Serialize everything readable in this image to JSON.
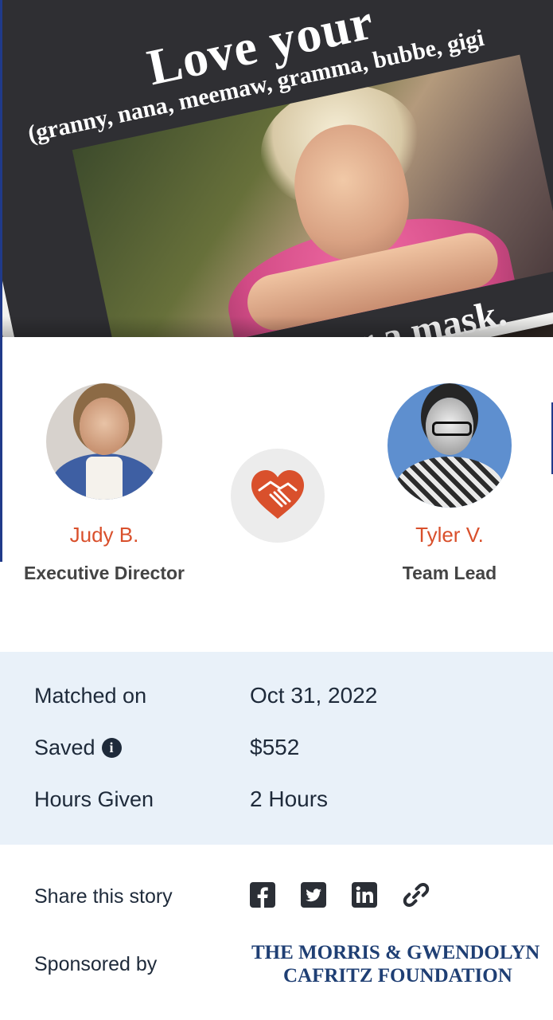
{
  "hero": {
    "card_title": "Love your",
    "card_subtitle": "(granny, nana, meemaw, gramma, bubbe, gigi",
    "card_footer": "Wear a mask."
  },
  "match": {
    "left": {
      "name": "Judy B.",
      "role": "Executive Director"
    },
    "right": {
      "name": "Tyler V.",
      "role": "Team Lead"
    },
    "center_icon": "handshake-heart-icon",
    "accent_color": "#d9502c"
  },
  "stats": {
    "rows": [
      {
        "label": "Matched on",
        "value": "Oct 31, 2022"
      },
      {
        "label": "Saved",
        "value": "$552"
      },
      {
        "label": "Hours Given",
        "value": "2 Hours"
      }
    ],
    "background_color": "#e9f1f9"
  },
  "share": {
    "label": "Share this story",
    "icons": [
      "facebook-icon",
      "twitter-icon",
      "linkedin-icon",
      "link-icon"
    ]
  },
  "sponsor": {
    "label": "Sponsored by",
    "line1": "THE MORRIS & GWENDOLYN",
    "line2": "CAFRITZ FOUNDATION"
  }
}
